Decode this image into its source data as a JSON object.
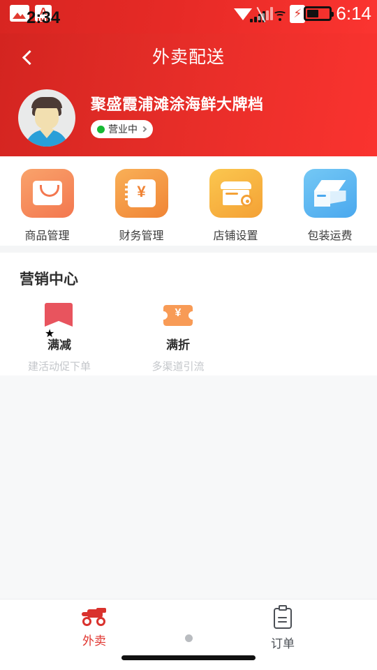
{
  "status_bar": {
    "time_white": "6:14",
    "time_black": "2:34",
    "icons": [
      "image-icon",
      "a-app-icon",
      "wifi-icon",
      "signal-bars-icon",
      "signal-off-icon",
      "wifi-small-icon",
      "battery-charging-icon",
      "battery-icon"
    ]
  },
  "header": {
    "title": "外卖配送",
    "back_label": "back-chevron"
  },
  "shop": {
    "name": "聚盛霞浦滩涂海鲜大牌档",
    "status_text": "营业中",
    "status_color": "#17b934"
  },
  "quick_actions": [
    {
      "label": "商品管理",
      "icon": "shopping-bag-icon",
      "color": "#f3774f"
    },
    {
      "label": "财务管理",
      "icon": "yen-ledger-icon",
      "color": "#f08435"
    },
    {
      "label": "店铺设置",
      "icon": "store-gear-icon",
      "color": "#f4a135"
    },
    {
      "label": "包装运费",
      "icon": "package-box-icon",
      "color": "#4aa8ee"
    }
  ],
  "marketing": {
    "title": "营销中心",
    "items": [
      {
        "name": "满减",
        "desc": "建活动促下单",
        "icon": "bookmark-star-icon",
        "color": "#e8545e"
      },
      {
        "name": "满折",
        "desc": "多渠道引流",
        "icon": "yen-ticket-icon",
        "color": "#f89b56"
      }
    ]
  },
  "tabbar": {
    "tabs": [
      {
        "label": "外卖",
        "icon": "scooter-icon",
        "active": true,
        "color": "#e0352f"
      },
      {
        "label": "订单",
        "icon": "clipboard-icon",
        "active": false,
        "color": "#4b4f55"
      }
    ]
  }
}
